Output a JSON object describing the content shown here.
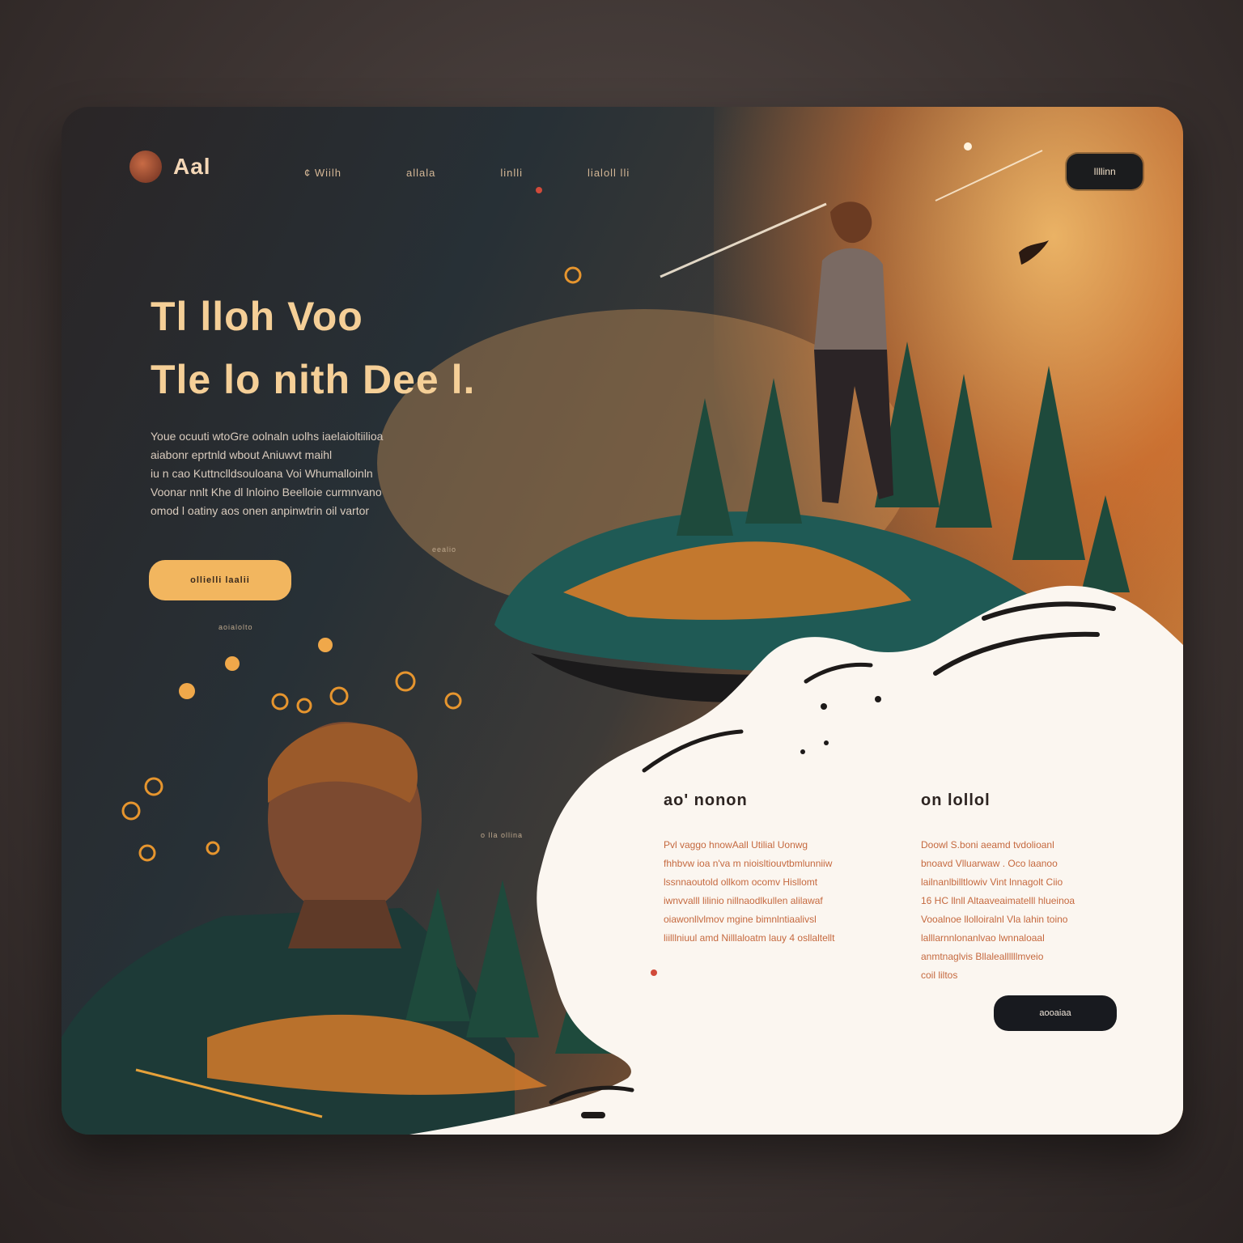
{
  "header": {
    "logo_text": "Aal",
    "nav_items": [
      "¢ Wiilh",
      "allala",
      "linlli",
      "lialoll lli"
    ],
    "nav_button_label": "Illlinn"
  },
  "hero": {
    "title_line_1": "Tl lloh Voo",
    "title_line_2": "Tle lo nith Dee l.",
    "body_lines": [
      "Youe ocuuti wtoGre oolnaln uolhs iaelaioltiilioa",
      "aiabonr eprtnld wbout Aniuwvt maihl",
      "iu n cao  Kuttnclldsouloana Voi Whumalloinln",
      "Voonar nnlt Khe dl lnloino Beelloie curmnvano",
      "omod l oatiny aos onen anpinwtrin oil vartor"
    ],
    "cta_label": "ollielli laalii",
    "caption_1": "eealio",
    "caption_2": "aoialolto",
    "caption_3": "o lla ollina"
  },
  "panel": {
    "blocks": [
      {
        "title": "ao' nonon",
        "lines": [
          "Pvl vaggo hnowAall Utilial Uonwg",
          "fhhbvw ioa n'va m nioisltiouvtbmlunniiw",
          "lssnnaoutold ollkom ocomv Hisllomt",
          "iwnvvalll lilinio nillnaodlkullen alilawaf",
          "oiawonllvlmov mgine bimnlntiaalivsl",
          "liilllniuul amd Nilllaloatm lauy 4 osllaltellt"
        ]
      },
      {
        "title": "on lollol",
        "lines": [
          "Doowl S.boni  aeamd tvdolioanl",
          "bnoavd Vlluarwaw . Oco laanoo",
          "lailnanlbilltlowiv Vint lnnagolt Ciio",
          "16 HC  llnll Altaaveaimatelll hlueinoa",
          "Vooalnoe llolloiralnl Vla lahin toino",
          "lalllarnnlonanlvao lwnnaloaal",
          "anmtnaglvis Bllaleallllllmveio",
          "coil liltos"
        ]
      }
    ],
    "button_label": "aooaiaa"
  },
  "colors": {
    "accent": "#f2b65f",
    "panel_bg": "#fbf6f0",
    "dark_button": "#181a1f",
    "dark_bg": "#273036"
  }
}
